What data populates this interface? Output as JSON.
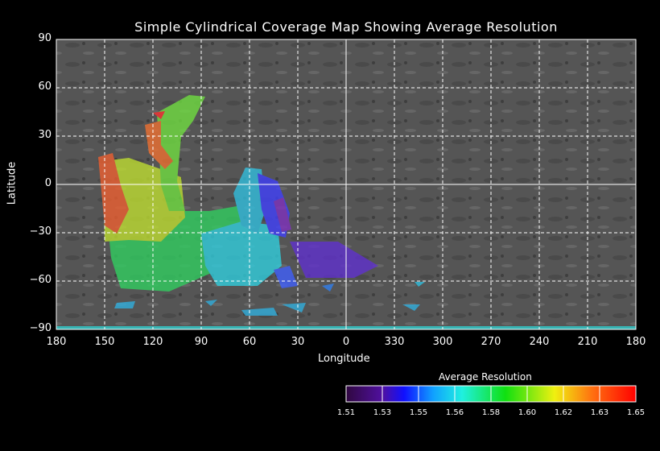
{
  "chart_data": {
    "type": "heatmap",
    "title": "Simple Cylindrical Coverage Map Showing Average Resolution",
    "xlabel": "Longitude",
    "ylabel": "Latitude",
    "xticks": [
      "180",
      "150",
      "120",
      "90",
      "60",
      "30",
      "0",
      "330",
      "300",
      "270",
      "240",
      "210",
      "180"
    ],
    "yticks": [
      "90",
      "60",
      "30",
      "0",
      "−30",
      "−60",
      "−90"
    ],
    "ylim": [
      -90,
      90
    ],
    "grid": true,
    "colorbar": {
      "title": "Average Resolution",
      "ticks": [
        "1.51",
        "1.53",
        "1.55",
        "1.56",
        "1.58",
        "1.60",
        "1.62",
        "1.63",
        "1.65"
      ],
      "colors": [
        "#3a0a60",
        "#2020ff",
        "#10a0ff",
        "#20f0d0",
        "#10e020",
        "#a0f010",
        "#ffb000",
        "#ff1010"
      ],
      "placement": "bottom-right"
    }
  }
}
